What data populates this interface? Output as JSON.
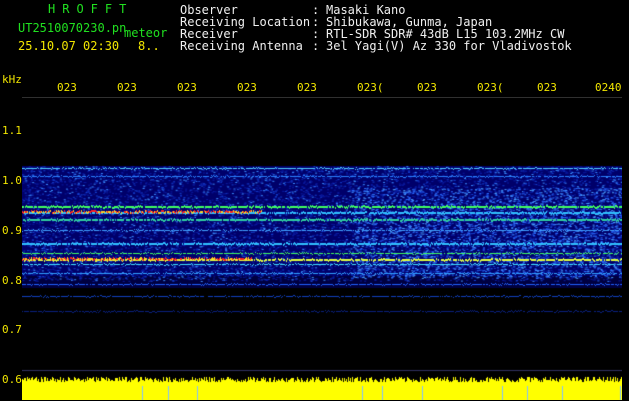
{
  "header": {
    "app_title": "HROFFT",
    "filename": "UT2510070230.pn",
    "meteor_label": "meteor",
    "datetime": "25.10.07 02:30",
    "count": "8.."
  },
  "station_info": [
    {
      "label": "Observer",
      "value": "Masaki Kano"
    },
    {
      "label": "Receiving Location",
      "value": "Shibukawa, Gunma, Japan"
    },
    {
      "label": "Receiver",
      "value": "RTL-SDR SDR# 43dB L15 103.2MHz CW"
    },
    {
      "label": "Receiving Antenna",
      "value": "3el Yagi(V) Az 330 for Vladivostok"
    }
  ],
  "colon": ":",
  "axis": {
    "unit": "kHz",
    "y_ticks": [
      "1.1",
      "1.0",
      "0.9",
      "0.8",
      "0.7",
      "0.6"
    ],
    "x_ticks": [
      "023",
      "023",
      "023",
      "023",
      "023",
      "023(",
      "023",
      "023(",
      "023",
      "0240"
    ]
  },
  "colors": {
    "header_green": "#20e020",
    "axis_yellow": "#f2e600",
    "background": "#000000",
    "spectrogram_base": "#00007a",
    "echo_red": "#ff2020",
    "noise_bar_yellow": "#ffff00"
  }
}
